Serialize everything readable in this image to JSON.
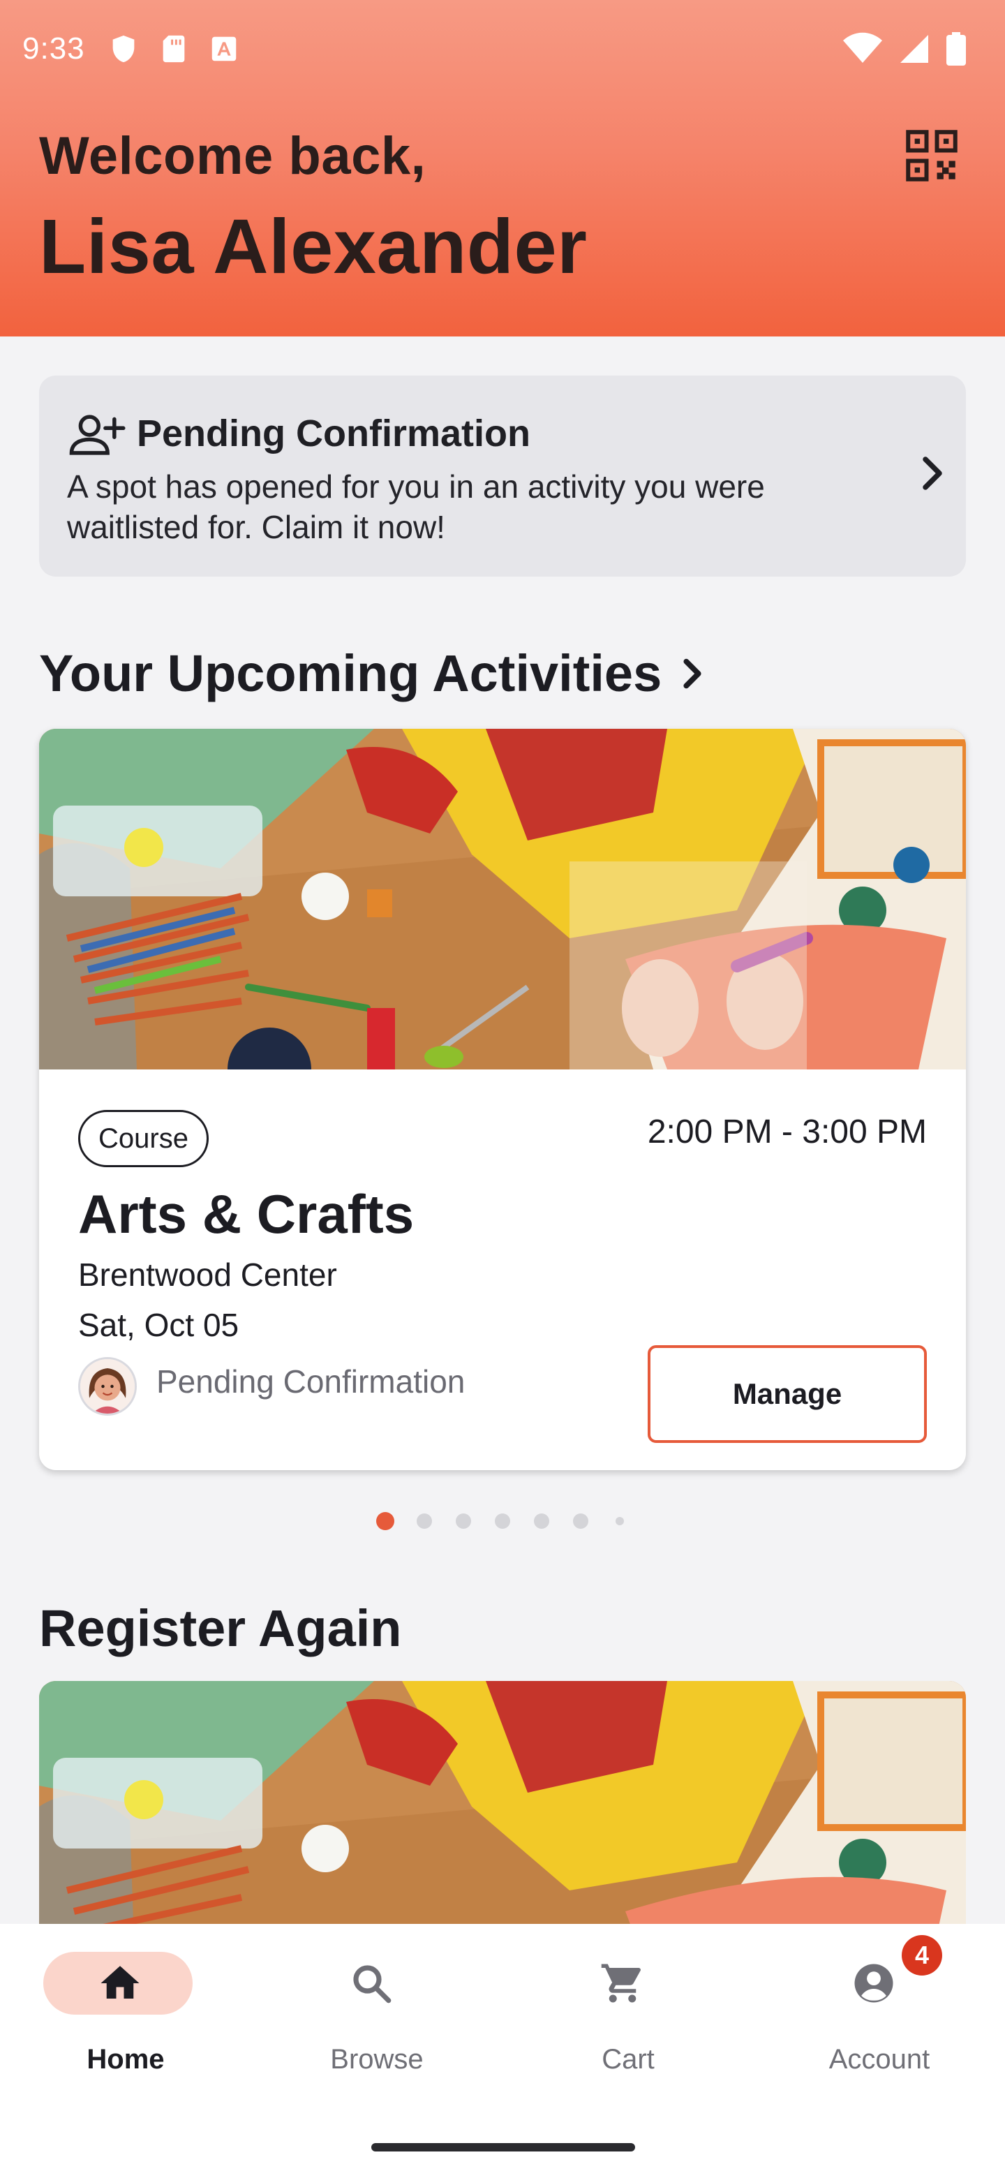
{
  "status_bar": {
    "time": "9:33",
    "left_icons": [
      "shield-icon",
      "sd-card-icon",
      "text-a-icon"
    ],
    "right_icons": [
      "wifi-icon",
      "signal-icon",
      "battery-icon"
    ]
  },
  "header": {
    "greeting": "Welcome back,",
    "user_name": "Lisa Alexander",
    "qr_icon": "qr-code-scan-icon"
  },
  "pending_banner": {
    "icon": "person-add-icon",
    "title": "Pending Confirmation",
    "message": "A spot has opened for you in an activity you were waitlisted for. Claim it now!"
  },
  "upcoming": {
    "title": "Your Upcoming Activities",
    "activity": {
      "type": "Course",
      "time": "2:00 PM - 3:00 PM",
      "name": "Arts & Crafts",
      "location": "Brentwood Center",
      "date": "Sat, Oct 05",
      "status": "Pending Confirmation",
      "manage_label": "Manage"
    },
    "carousel_total": 7,
    "carousel_active": 0
  },
  "register_again": {
    "title": "Register Again"
  },
  "bottom_nav": {
    "items": [
      {
        "label": "Home",
        "icon": "home-icon",
        "active": true
      },
      {
        "label": "Browse",
        "icon": "search-icon",
        "active": false
      },
      {
        "label": "Cart",
        "icon": "cart-icon",
        "active": false
      },
      {
        "label": "Account",
        "icon": "account-icon",
        "active": false
      }
    ],
    "account_badge": "4"
  },
  "colors": {
    "accent": "#e65a3a",
    "header_top": "#f79a84",
    "header_bottom": "#f2623e",
    "nav_pill": "#fbd5cb",
    "badge": "#d9361e"
  }
}
